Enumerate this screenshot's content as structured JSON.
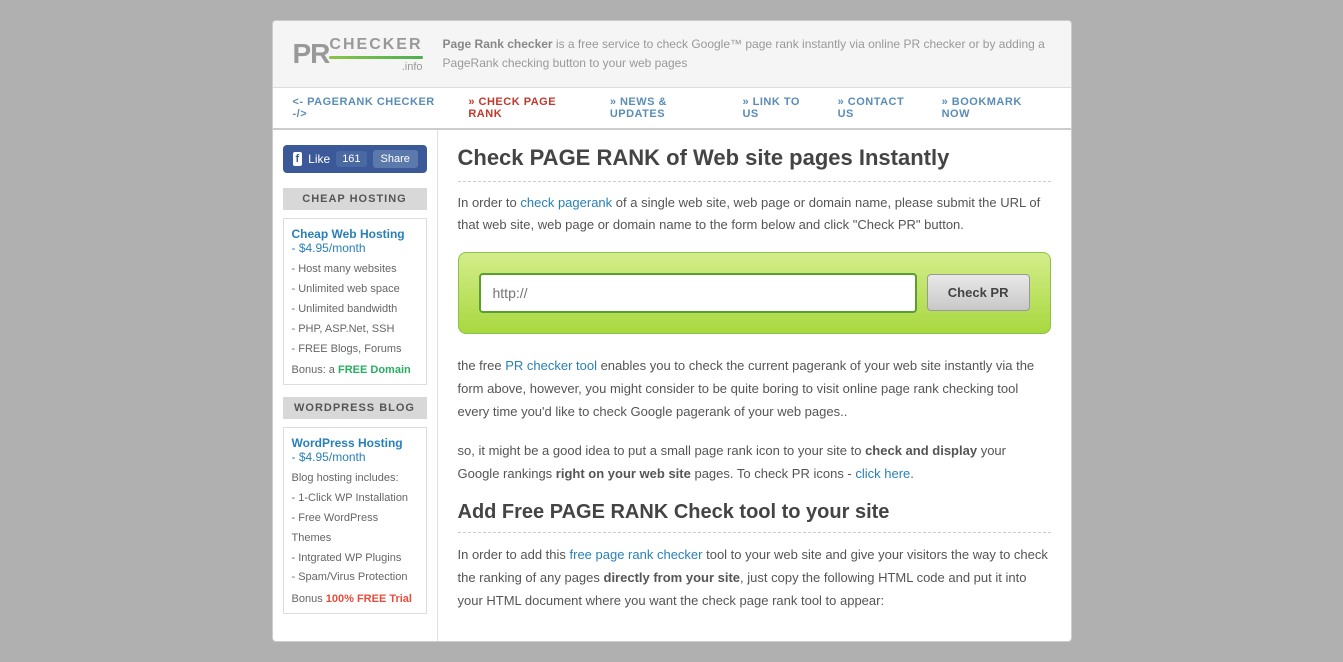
{
  "header": {
    "logo_pr": "PR",
    "logo_checker": "CHECKER",
    "logo_info": ".info",
    "desc": "Page Rank checker",
    "desc_suffix": " is a free service to check Google™ page rank instantly via online PR checker or by adding a PageRank checking button to your web pages"
  },
  "nav": {
    "items": [
      {
        "label": "<- PAGERANK CHECKER -/>",
        "active": false
      },
      {
        "label": "» CHECK PAGE RANK",
        "active": true
      },
      {
        "label": "» NEWS & UPDATES",
        "active": false
      },
      {
        "label": "» LINK TO US",
        "active": false
      },
      {
        "label": "» CONTACT US",
        "active": false
      },
      {
        "label": "» BOOKMARK NOW",
        "active": false
      }
    ]
  },
  "sidebar": {
    "fb_like": "Like",
    "fb_count": "161",
    "fb_share": "Share",
    "cheap_hosting_title": "CHEAP HOSTING",
    "cheap_hosting": {
      "name": "Cheap Web Hosting",
      "price": "- $4.95/month",
      "features": [
        "- Host many websites",
        "- Unlimited web space",
        "- Unlimited bandwidth",
        "- PHP, ASP.Net, SSH",
        "- FREE Blogs, Forums"
      ],
      "bonus_label": "Bonus: a ",
      "bonus_link": "FREE Domain"
    },
    "wordpress_title": "WORDPRESS BLOG",
    "wordpress": {
      "name": "WordPress Hosting",
      "price": "- $4.95/month",
      "intro": "Blog hosting includes:",
      "features": [
        "- 1-Click WP Installation",
        "- Free WordPress Themes",
        "- Intgrated WP Plugins",
        "- Spam/Virus Protection"
      ],
      "bonus_label": "Bonus ",
      "bonus_link": "100% FREE Trial"
    }
  },
  "main": {
    "title": "Check PAGE RANK of Web site pages Instantly",
    "intro": "In order to ",
    "intro_link": "check pagerank",
    "intro_suffix": " of a single web site, web page or domain name, please submit the URL of that web site, web page or domain name to the form below and click \"Check PR\" button.",
    "input_placeholder": "http://",
    "btn_check": "Check PR",
    "desc1": "the free ",
    "desc1_link": "PR checker tool",
    "desc1_suffix": " enables you to check the current pagerank of your web site instantly via the form above, however, you might consider to be quite boring to visit online page rank checking tool every time you'd like to check Google pagerank of your web pages..",
    "desc2_pre": "so, it might be a good idea to put a small page rank icon to your site to ",
    "desc2_bold": "check and display",
    "desc2_mid": " your Google rankings ",
    "desc2_bold2": "right on your web site",
    "desc2_suf": " pages. To check PR icons - ",
    "desc2_link": "click here",
    "desc2_end": ".",
    "section2_title": "Add Free PAGE RANK Check tool to your site",
    "section2_text": "In order to add this ",
    "section2_link": "free page rank checker",
    "section2_suffix": " tool to your web site and give your visitors the way to check the ranking of any pages ",
    "section2_bold": "directly from your site",
    "section2_suf2": ", just copy the following HTML code and put it into your HTML document where you want the check page rank tool to appear:"
  }
}
